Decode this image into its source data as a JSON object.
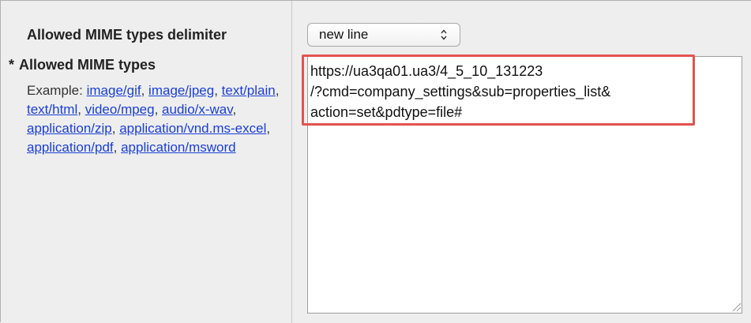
{
  "form": {
    "delimiter_label": "Allowed MIME types delimiter",
    "delimiter_select": {
      "selected": "new line",
      "icon": "updown-arrows-icon"
    },
    "mime_label": {
      "required_mark": "*",
      "text": "Allowed MIME types"
    },
    "help": {
      "prefix": "Example:",
      "examples": [
        "image/gif",
        "image/jpeg",
        "text/plain",
        "text/html",
        "video/mpeg",
        "audio/x-wav",
        "application/zip",
        "application/vnd.ms-excel",
        "application/pdf",
        "application/msword"
      ]
    },
    "mime_textarea": {
      "lines": [
        "https://ua3qa01.ua3/4_5_10_131223",
        "/?cmd=company_settings&sub=properties_list&",
        "action=set&pdtype=file#"
      ]
    }
  },
  "colors": {
    "link": "#1a3fd6",
    "highlight": "#e2534f",
    "cell_bg": "#eeeeee"
  }
}
